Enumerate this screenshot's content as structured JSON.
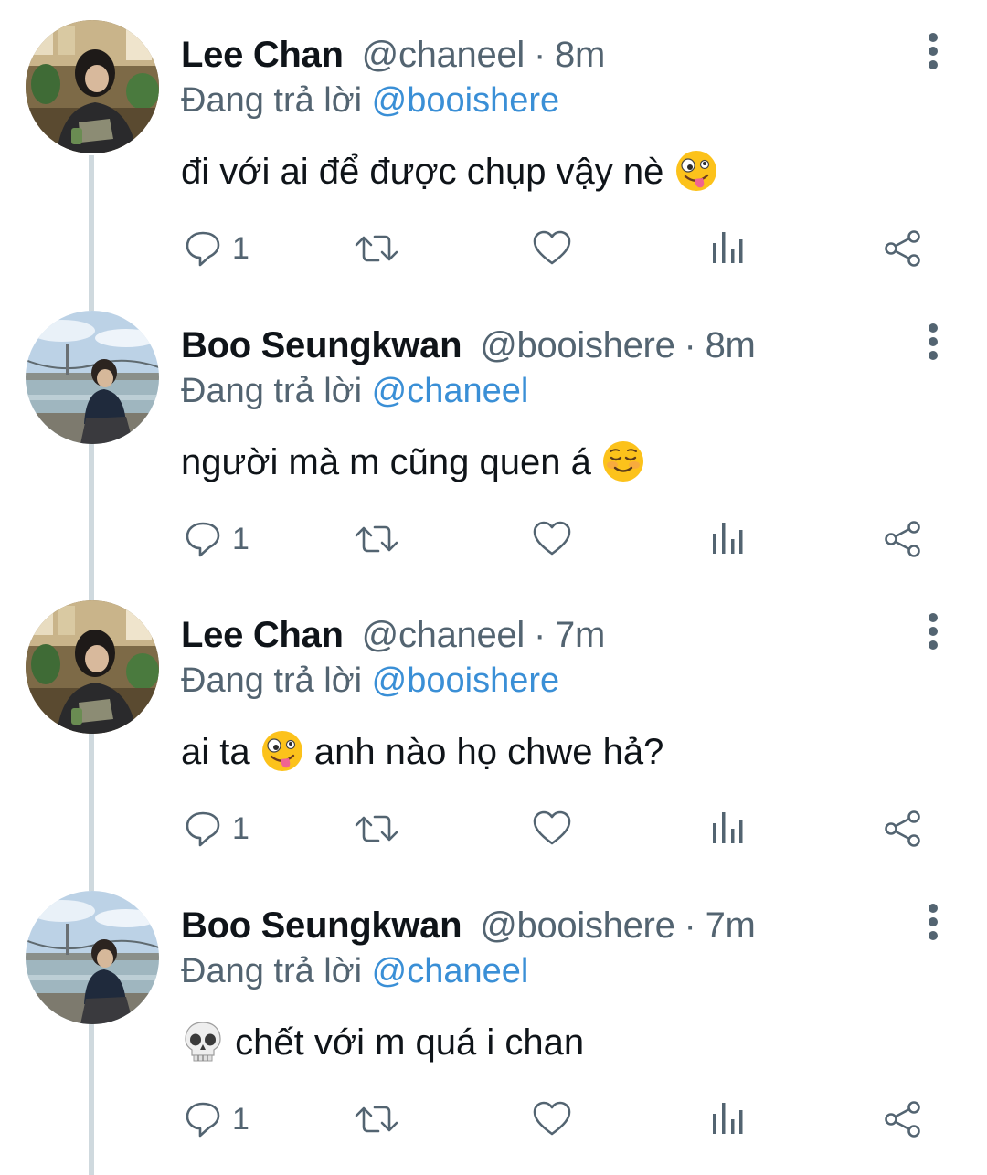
{
  "tweets": [
    {
      "name": "Lee Chan",
      "handle": "@chaneel",
      "separator": "·",
      "time": "8m",
      "replying_prefix": "Đang trả lời",
      "replying_to": "@booishere",
      "text_before": "đi với ai để được chụp vậy nè ",
      "emoji": "zany-face",
      "text_after": "",
      "reply_count": "1",
      "avatar_scene": "cafe-interior"
    },
    {
      "name": "Boo Seungkwan",
      "handle": "@booishere",
      "separator": "·",
      "time": "8m",
      "replying_prefix": "Đang trả lời",
      "replying_to": "@chaneel",
      "text_before": "người mà m cũng quen á ",
      "emoji": "smiling-face",
      "text_after": "",
      "reply_count": "1",
      "avatar_scene": "river-bridge"
    },
    {
      "name": "Lee Chan",
      "handle": "@chaneel",
      "separator": "·",
      "time": "7m",
      "replying_prefix": "Đang trả lời",
      "replying_to": "@booishere",
      "text_before": "ai ta ",
      "emoji": "zany-face",
      "text_after": " anh nào họ chwe hả?",
      "reply_count": "1",
      "avatar_scene": "cafe-interior"
    },
    {
      "name": "Boo Seungkwan",
      "handle": "@booishere",
      "separator": "·",
      "time": "7m",
      "replying_prefix": "Đang trả lời",
      "replying_to": "@chaneel",
      "text_before": "",
      "emoji": "skull",
      "text_after": " chết với m quá i chan",
      "reply_count": "1",
      "avatar_scene": "river-bridge"
    }
  ],
  "action_icons": [
    "reply-icon",
    "retweet-icon",
    "like-icon",
    "views-icon",
    "share-icon"
  ],
  "more_icon": "more-vertical-icon",
  "colors": {
    "text_primary": "#0f1419",
    "text_secondary": "#536471",
    "link": "#3a8fd6",
    "thread_line": "#cfd9de",
    "background": "#ffffff"
  }
}
